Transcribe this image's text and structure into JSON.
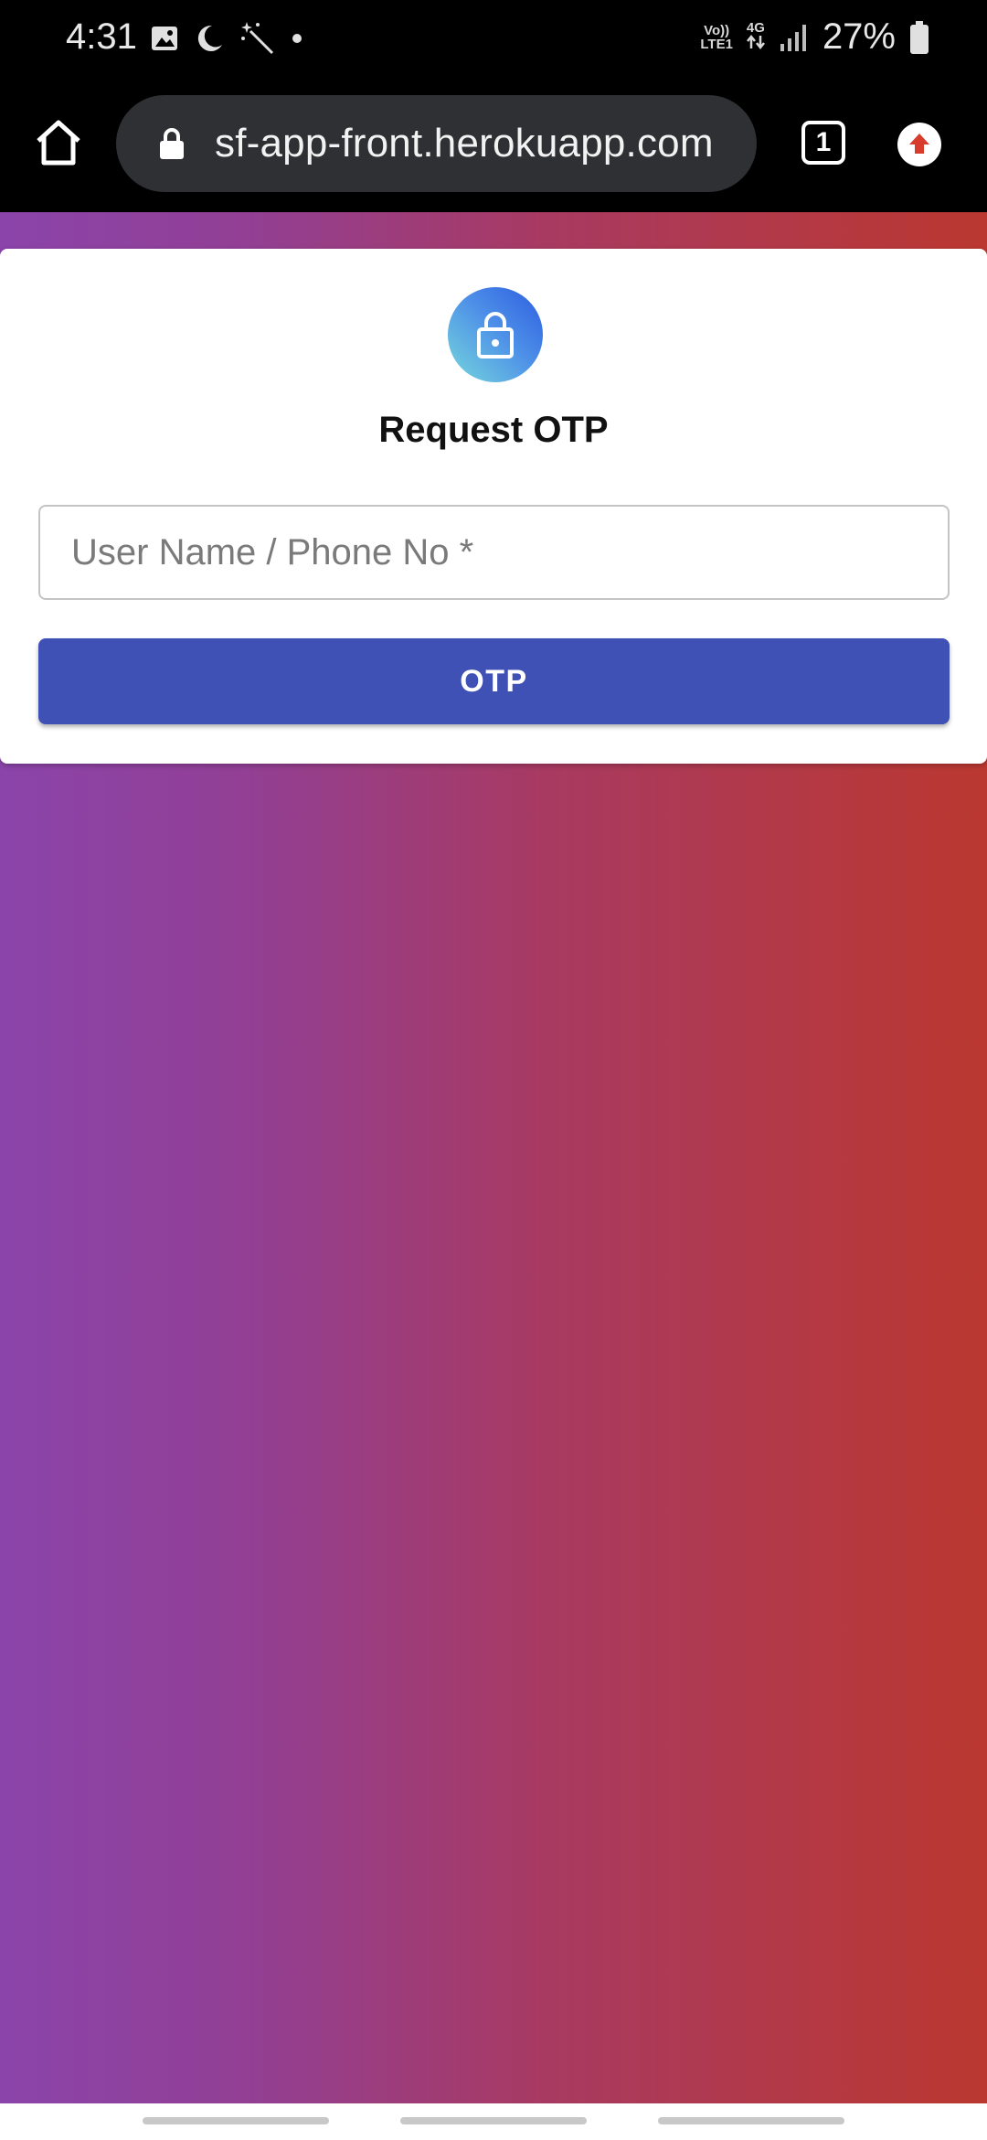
{
  "status_bar": {
    "time": "4:31",
    "network_top": "Vo))",
    "network_bottom": "LTE1",
    "network_type": "4G",
    "battery": "27%"
  },
  "browser": {
    "url": "sf-app-front.herokuapp.com",
    "tab_count": "1"
  },
  "card": {
    "title": "Request OTP",
    "username_placeholder": "User Name / Phone No *",
    "username_value": "",
    "otp_button_label": "OTP"
  },
  "colors": {
    "primary": "#3f51b5",
    "gradient_start": "#8b44aa",
    "gradient_end": "#bb3830"
  }
}
